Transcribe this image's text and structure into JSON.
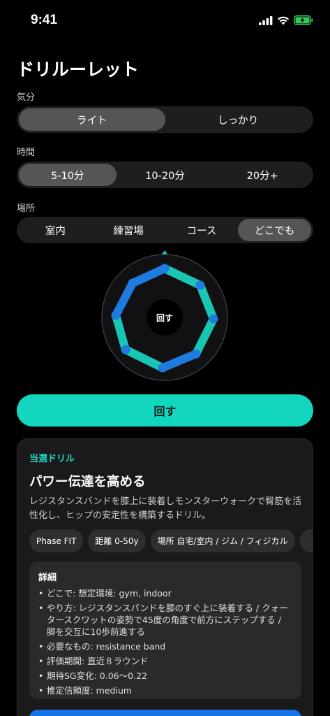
{
  "status": {
    "time": "9:41"
  },
  "page_title": "ドリルーレット",
  "mood": {
    "label": "気分",
    "options": [
      "ライト",
      "しっかり"
    ],
    "selected": "ライト"
  },
  "time": {
    "label": "時間",
    "options": [
      "5-10分",
      "10-20分",
      "20分+"
    ],
    "selected": "5-10分"
  },
  "place": {
    "label": "場所",
    "options": [
      "室内",
      "練習場",
      "コース",
      "どこでも"
    ],
    "selected": "どこでも"
  },
  "wheel": {
    "center_label": "回す"
  },
  "spin_button": "回す",
  "result": {
    "kicker": "当選ドリル",
    "title": "パワー伝達を高める",
    "description": "レジスタンスバンドを膝上に装着しモンスターウォークで臀筋を活性化し、ヒップの安定性を構築するドリル。",
    "chips": [
      "Phase FIT",
      "距離 0-50y",
      "場所 自宅/室内 / ジム / フィジカル"
    ],
    "details_title": "詳細",
    "details": [
      "どこで: 想定環境: gym, indoor",
      "やり方: レジスタンスバンドを膝のすぐ上に装着する / クォータースクワットの姿勢で45度の角度で前方にステップする / 脚を交互に10歩前進する",
      "必要なもの: resistance band",
      "評価期間: 直近８ラウンド",
      "期待SG変化: 0.06〜0.22",
      "推定信頼度: medium"
    ]
  },
  "colors": {
    "accent": "#12d6be",
    "segment_blue": "#1e7be0",
    "segment_teal": "#19c6b4",
    "primary_blue": "#1a73e8"
  }
}
